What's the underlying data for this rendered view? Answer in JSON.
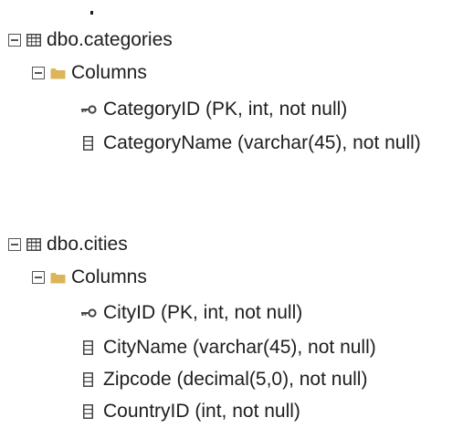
{
  "tree": {
    "tables": [
      {
        "name": "dbo.categories",
        "folder": "Columns",
        "columns": [
          {
            "label": "CategoryID (PK, int, not null)",
            "icon": "key-icon"
          },
          {
            "label": "CategoryName (varchar(45), not null)",
            "icon": "column-icon"
          }
        ]
      },
      {
        "name": "dbo.cities",
        "folder": "Columns",
        "columns": [
          {
            "label": "CityID (PK, int, not null)",
            "icon": "key-icon"
          },
          {
            "label": "CityName (varchar(45), not null)",
            "icon": "column-icon"
          },
          {
            "label": "Zipcode (decimal(5,0), not null)",
            "icon": "column-icon"
          },
          {
            "label": "CountryID (int, not null)",
            "icon": "column-icon"
          }
        ]
      }
    ]
  },
  "colors": {
    "text": "#1e1e1e",
    "folder": "#dcb45a",
    "icon": "#555555"
  }
}
